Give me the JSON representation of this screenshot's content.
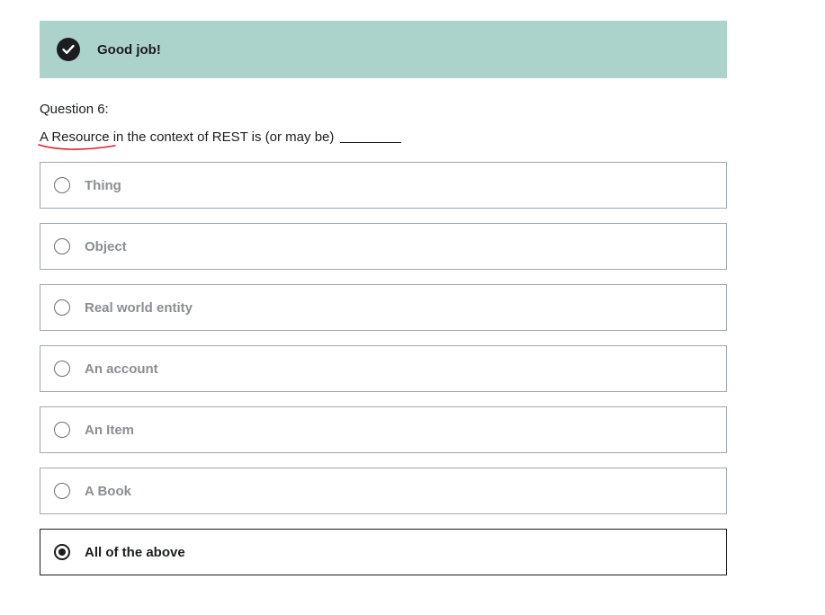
{
  "banner": {
    "message": "Good job!",
    "icon": "check-icon",
    "background_color": "#acd2cc"
  },
  "question": {
    "number_label": "Question 6:",
    "text_part1": "A Resource",
    "text_part2": " in the context of REST is (or may be)",
    "underline_color": "#e0202a"
  },
  "options": [
    {
      "label": "Thing",
      "selected": false
    },
    {
      "label": "Object",
      "selected": false
    },
    {
      "label": "Real world entity",
      "selected": false
    },
    {
      "label": "An account",
      "selected": false
    },
    {
      "label": "An Item",
      "selected": false
    },
    {
      "label": "A Book",
      "selected": false
    },
    {
      "label": "All of the above",
      "selected": true
    }
  ]
}
